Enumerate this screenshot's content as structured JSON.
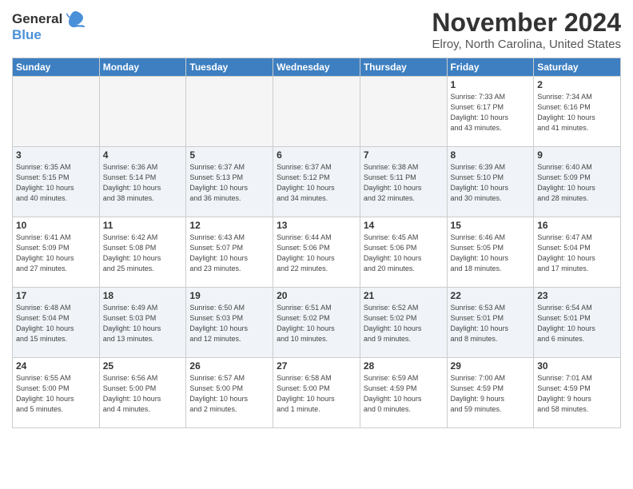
{
  "logo": {
    "general": "General",
    "blue": "Blue",
    "bird_symbol": "🐦"
  },
  "header": {
    "month": "November 2024",
    "location": "Elroy, North Carolina, United States"
  },
  "days_of_week": [
    "Sunday",
    "Monday",
    "Tuesday",
    "Wednesday",
    "Thursday",
    "Friday",
    "Saturday"
  ],
  "weeks": [
    {
      "days": [
        {
          "number": "",
          "info": ""
        },
        {
          "number": "",
          "info": ""
        },
        {
          "number": "",
          "info": ""
        },
        {
          "number": "",
          "info": ""
        },
        {
          "number": "",
          "info": ""
        },
        {
          "number": "1",
          "info": "Sunrise: 7:33 AM\nSunset: 6:17 PM\nDaylight: 10 hours\nand 43 minutes."
        },
        {
          "number": "2",
          "info": "Sunrise: 7:34 AM\nSunset: 6:16 PM\nDaylight: 10 hours\nand 41 minutes."
        }
      ]
    },
    {
      "days": [
        {
          "number": "3",
          "info": "Sunrise: 6:35 AM\nSunset: 5:15 PM\nDaylight: 10 hours\nand 40 minutes."
        },
        {
          "number": "4",
          "info": "Sunrise: 6:36 AM\nSunset: 5:14 PM\nDaylight: 10 hours\nand 38 minutes."
        },
        {
          "number": "5",
          "info": "Sunrise: 6:37 AM\nSunset: 5:13 PM\nDaylight: 10 hours\nand 36 minutes."
        },
        {
          "number": "6",
          "info": "Sunrise: 6:37 AM\nSunset: 5:12 PM\nDaylight: 10 hours\nand 34 minutes."
        },
        {
          "number": "7",
          "info": "Sunrise: 6:38 AM\nSunset: 5:11 PM\nDaylight: 10 hours\nand 32 minutes."
        },
        {
          "number": "8",
          "info": "Sunrise: 6:39 AM\nSunset: 5:10 PM\nDaylight: 10 hours\nand 30 minutes."
        },
        {
          "number": "9",
          "info": "Sunrise: 6:40 AM\nSunset: 5:09 PM\nDaylight: 10 hours\nand 28 minutes."
        }
      ]
    },
    {
      "days": [
        {
          "number": "10",
          "info": "Sunrise: 6:41 AM\nSunset: 5:09 PM\nDaylight: 10 hours\nand 27 minutes."
        },
        {
          "number": "11",
          "info": "Sunrise: 6:42 AM\nSunset: 5:08 PM\nDaylight: 10 hours\nand 25 minutes."
        },
        {
          "number": "12",
          "info": "Sunrise: 6:43 AM\nSunset: 5:07 PM\nDaylight: 10 hours\nand 23 minutes."
        },
        {
          "number": "13",
          "info": "Sunrise: 6:44 AM\nSunset: 5:06 PM\nDaylight: 10 hours\nand 22 minutes."
        },
        {
          "number": "14",
          "info": "Sunrise: 6:45 AM\nSunset: 5:06 PM\nDaylight: 10 hours\nand 20 minutes."
        },
        {
          "number": "15",
          "info": "Sunrise: 6:46 AM\nSunset: 5:05 PM\nDaylight: 10 hours\nand 18 minutes."
        },
        {
          "number": "16",
          "info": "Sunrise: 6:47 AM\nSunset: 5:04 PM\nDaylight: 10 hours\nand 17 minutes."
        }
      ]
    },
    {
      "days": [
        {
          "number": "17",
          "info": "Sunrise: 6:48 AM\nSunset: 5:04 PM\nDaylight: 10 hours\nand 15 minutes."
        },
        {
          "number": "18",
          "info": "Sunrise: 6:49 AM\nSunset: 5:03 PM\nDaylight: 10 hours\nand 13 minutes."
        },
        {
          "number": "19",
          "info": "Sunrise: 6:50 AM\nSunset: 5:03 PM\nDaylight: 10 hours\nand 12 minutes."
        },
        {
          "number": "20",
          "info": "Sunrise: 6:51 AM\nSunset: 5:02 PM\nDaylight: 10 hours\nand 10 minutes."
        },
        {
          "number": "21",
          "info": "Sunrise: 6:52 AM\nSunset: 5:02 PM\nDaylight: 10 hours\nand 9 minutes."
        },
        {
          "number": "22",
          "info": "Sunrise: 6:53 AM\nSunset: 5:01 PM\nDaylight: 10 hours\nand 8 minutes."
        },
        {
          "number": "23",
          "info": "Sunrise: 6:54 AM\nSunset: 5:01 PM\nDaylight: 10 hours\nand 6 minutes."
        }
      ]
    },
    {
      "days": [
        {
          "number": "24",
          "info": "Sunrise: 6:55 AM\nSunset: 5:00 PM\nDaylight: 10 hours\nand 5 minutes."
        },
        {
          "number": "25",
          "info": "Sunrise: 6:56 AM\nSunset: 5:00 PM\nDaylight: 10 hours\nand 4 minutes."
        },
        {
          "number": "26",
          "info": "Sunrise: 6:57 AM\nSunset: 5:00 PM\nDaylight: 10 hours\nand 2 minutes."
        },
        {
          "number": "27",
          "info": "Sunrise: 6:58 AM\nSunset: 5:00 PM\nDaylight: 10 hours\nand 1 minute."
        },
        {
          "number": "28",
          "info": "Sunrise: 6:59 AM\nSunset: 4:59 PM\nDaylight: 10 hours\nand 0 minutes."
        },
        {
          "number": "29",
          "info": "Sunrise: 7:00 AM\nSunset: 4:59 PM\nDaylight: 9 hours\nand 59 minutes."
        },
        {
          "number": "30",
          "info": "Sunrise: 7:01 AM\nSunset: 4:59 PM\nDaylight: 9 hours\nand 58 minutes."
        }
      ]
    }
  ]
}
